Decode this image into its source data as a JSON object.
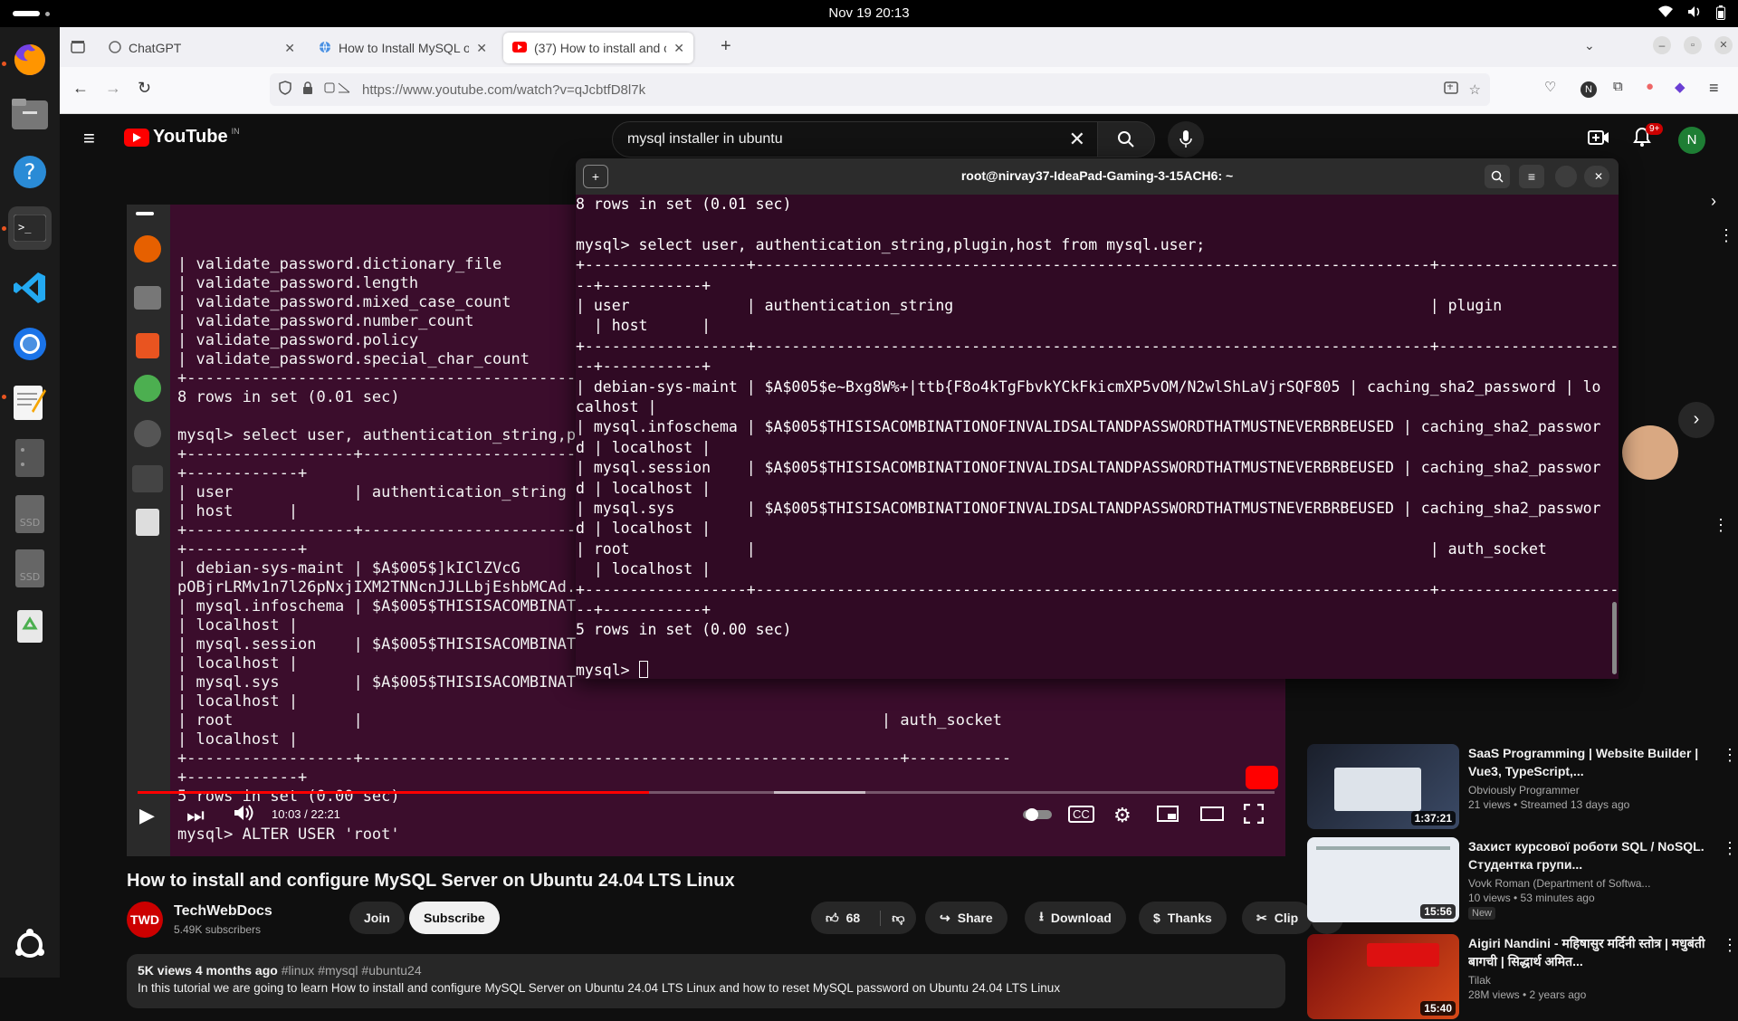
{
  "system": {
    "clock": "Nov 19  20:13"
  },
  "dock": {
    "apps": [
      "firefox-icon",
      "files-icon",
      "help-icon",
      "terminal-icon",
      "vscode-icon",
      "chromium-icon",
      "text-editor-icon",
      "drive-icon",
      "ssd-icon",
      "ssd-icon",
      "trash-icon"
    ],
    "ssd_label": "SSD"
  },
  "browser": {
    "tabs": [
      {
        "label": "ChatGPT"
      },
      {
        "label": "How to Install MySQL on "
      },
      {
        "label": "(37) How to install and co"
      }
    ],
    "url": "https://www.youtube.com/watch?v=qJcbtfD8l7k"
  },
  "youtube": {
    "logo": "YouTube",
    "country": "IN",
    "search_query": "mysql installer in ubuntu",
    "notif_count": "9+",
    "account_initial": "N"
  },
  "video": {
    "title": "How to install and configure MySQL Server on Ubuntu 24.04 LTS Linux",
    "time": "10:03 / 22:21",
    "channel": {
      "name": "TechWebDocs",
      "subs": "5.49K subscribers",
      "avatar_text": "TWD"
    },
    "join_label": "Join",
    "subscribe_label": "Subscribe",
    "likes": "68",
    "share_label": "Share",
    "download_label": "Download",
    "thanks_label": "Thanks",
    "clip_label": "Clip",
    "views": "5K views  4 months ago",
    "tags": "#linux #mysql #ubuntu24",
    "description": "In this tutorial we are going to learn How to install and configure MySQL Server on Ubuntu 24.04 LTS Linux and how to reset MySQL password on Ubuntu 24.04 LTS Linux",
    "progress": 0.45
  },
  "player_terminal": {
    "lines": [
      "| validate_password.dictionary_file",
      "| validate_password.length",
      "| validate_password.mixed_case_count",
      "| validate_password.number_count",
      "| validate_password.policy",
      "| validate_password.special_char_count",
      "+-------------------------------------------",
      "8 rows in set (0.01 sec)",
      "",
      "mysql> select user, authentication_string,p",
      "+------------------+------------------------",
      "+------------+",
      "| user             | authentication_string",
      "| host      |",
      "+------------------+------------------------",
      "+------------+",
      "| debian-sys-maint | $A$005$]kIClZVcG",
      "pOBjrLRMv1n7l26pNxjIXM2TNNcnJJLLbjEshbMCAd.",
      "| mysql.infoschema | $A$005$THISISACOMBINAT",
      "| localhost |",
      "| mysql.session    | $A$005$THISISACOMBINAT",
      "| localhost |",
      "| mysql.sys        | $A$005$THISISACOMBINAT",
      "| localhost |",
      "| root             |                                                        | auth_socket",
      "| localhost |",
      "+------------------+----------------------------------------------------------+-----------",
      "+------------+",
      "5 rows in set (0.00 sec)",
      "",
      "mysql> ALTER USER 'root'"
    ]
  },
  "terminal": {
    "title": "root@nirvay37-IdeaPad-Gaming-3-15ACH6: ~",
    "lines": [
      "8 rows in set (0.01 sec)",
      "",
      "mysql> select user, authentication_string,plugin,host from mysql.user;",
      "+------------------+---------------------------------------------------------------------------+--------------------",
      "--+-----------+",
      "| user             | authentication_string                                                     | plugin",
      "  | host      |",
      "+------------------+---------------------------------------------------------------------------+--------------------",
      "--+-----------+",
      "| debian-sys-maint | $A$005$e~Bxg8W%+|ttb{F8o4kTgFbvkYCkFkicmXP5vOM/N2wlShLaVjrSQF805 | caching_sha2_password | lo",
      "calhost |",
      "| mysql.infoschema | $A$005$THISISACOMBINATIONOFINVALIDSALTANDPASSWORDTHATMUSTNEVERBRBEUSED | caching_sha2_passwor",
      "d | localhost |",
      "| mysql.session    | $A$005$THISISACOMBINATIONOFINVALIDSALTANDPASSWORDTHATMUSTNEVERBRBEUSED | caching_sha2_passwor",
      "d | localhost |",
      "| mysql.sys        | $A$005$THISISACOMBINATIONOFINVALIDSALTANDPASSWORDTHATMUSTNEVERBRBEUSED | caching_sha2_passwor",
      "d | localhost |",
      "| root             |                                                                           | auth_socket",
      "  | localhost |",
      "+------------------+---------------------------------------------------------------------------+--------------------",
      "--+-----------+",
      "5 rows in set (0.00 sec)",
      "",
      "mysql> "
    ]
  },
  "sidebar": {
    "videos": [
      {
        "title": "SaaS Programming | Website Builder | Vue3, TypeScript,...",
        "channel": "Obviously Programmer",
        "meta": "21 views • Streamed 13 days ago",
        "duration": "1:37:21",
        "badge": ""
      },
      {
        "title": "Захист курсової роботи SQL / NoSQL. Студентка групи...",
        "channel": "Vovk Roman (Department of Softwa...",
        "meta": "10 views • 53 minutes ago",
        "duration": "15:56",
        "badge": "New"
      },
      {
        "title": "Aigiri Nandini - महिषासुर मर्दिनी स्तोत्र | मधुबंती बागची | सिद्धार्थ अमित...",
        "channel": "Tilak",
        "meta": "28M views • 2 years ago",
        "duration": "15:40",
        "badge": ""
      }
    ]
  },
  "colors": {
    "yt_red": "#ff0000",
    "terminal_bg": "#300a24",
    "ubuntu_orange": "#e95420"
  }
}
